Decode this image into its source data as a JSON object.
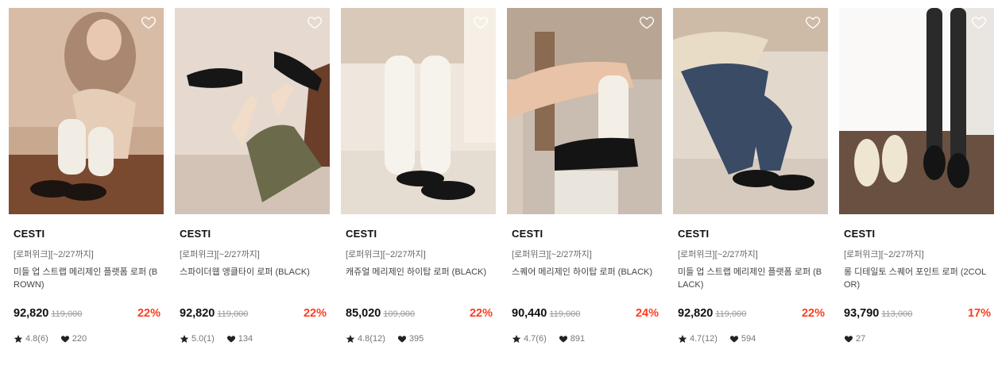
{
  "products": [
    {
      "brand": "CESTI",
      "promo": "[로퍼위크][~2/27까지]",
      "name": "미들 업 스트랩 메리제인 플랫폼 로퍼 (BROWN)",
      "price": "92,820",
      "original_price": "119,000",
      "discount": "22%",
      "rating": "4.8(6)",
      "likes": "220"
    },
    {
      "brand": "CESTI",
      "promo": "[로퍼위크][~2/27까지]",
      "name": "스파이더웹 앵클타이 로퍼 (BLACK)",
      "price": "92,820",
      "original_price": "119,000",
      "discount": "22%",
      "rating": "5.0(1)",
      "likes": "134"
    },
    {
      "brand": "CESTI",
      "promo": "[로퍼위크][~2/27까지]",
      "name": "캐쥬얼 메리제인 하이탑 로퍼 (BLACK)",
      "price": "85,020",
      "original_price": "109,000",
      "discount": "22%",
      "rating": "4.8(12)",
      "likes": "395"
    },
    {
      "brand": "CESTI",
      "promo": "[로퍼위크][~2/27까지]",
      "name": "스퀘어 메리제인 하이탑 로퍼 (BLACK)",
      "price": "90,440",
      "original_price": "119,000",
      "discount": "24%",
      "rating": "4.7(6)",
      "likes": "891"
    },
    {
      "brand": "CESTI",
      "promo": "[로퍼위크][~2/27까지]",
      "name": "미들 업 스트랩 메리제인 플랫폼 로퍼 (BLACK)",
      "price": "92,820",
      "original_price": "119,000",
      "discount": "22%",
      "rating": "4.7(12)",
      "likes": "594"
    },
    {
      "brand": "CESTI",
      "promo": "[로퍼위크][~2/27까지]",
      "name": "롱 디테일토 스퀘어 포인트 로퍼 (2COLOR)",
      "price": "93,790",
      "original_price": "113,000",
      "discount": "17%",
      "rating": null,
      "likes": "27"
    }
  ],
  "icons": {
    "wishlist": "heart-outline-icon",
    "rating": "star-icon",
    "likes": "heart-filled-icon"
  },
  "colors": {
    "discount": "#ff3b1f",
    "price": "#111111",
    "original_price": "#999999"
  }
}
